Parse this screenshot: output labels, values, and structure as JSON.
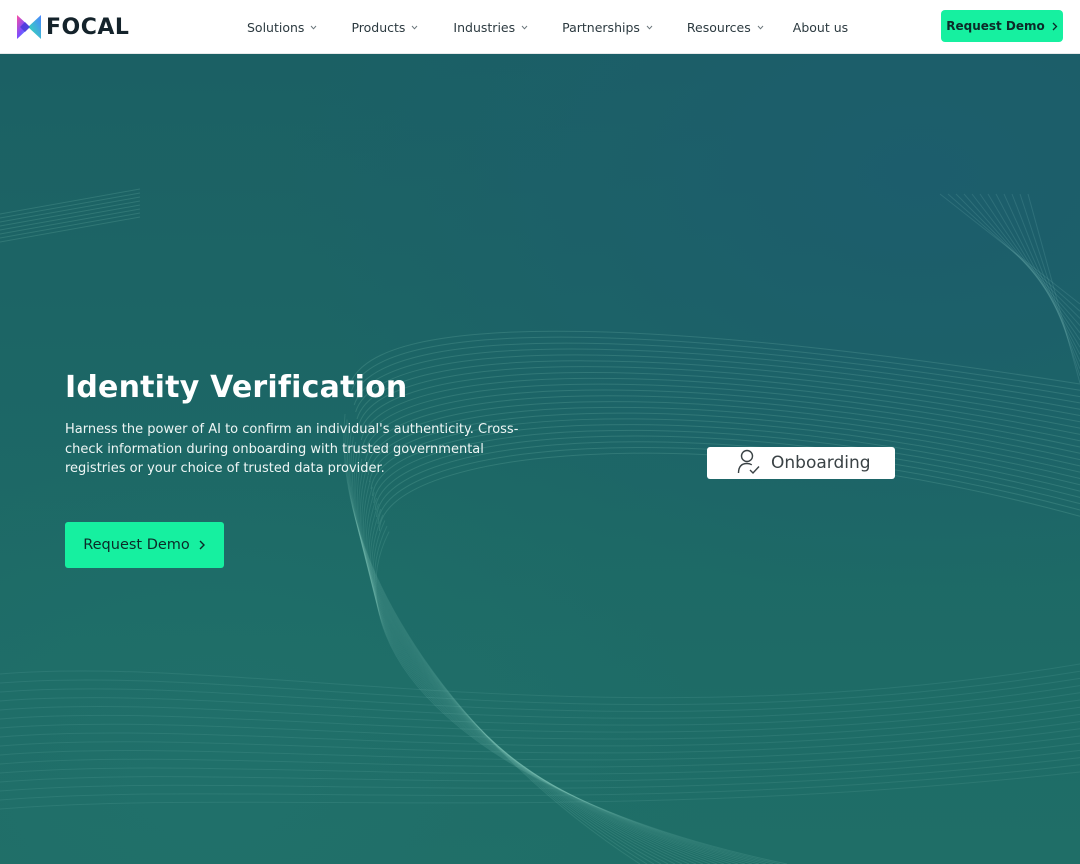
{
  "brand": {
    "name": "FOCAL",
    "logo_icon": "focal-logo-icon"
  },
  "nav": {
    "items": [
      {
        "label": "Solutions",
        "has_dropdown": true
      },
      {
        "label": "Products",
        "has_dropdown": true
      },
      {
        "label": "Industries",
        "has_dropdown": true
      },
      {
        "label": "Partnerships",
        "has_dropdown": true
      },
      {
        "label": "Resources",
        "has_dropdown": true
      },
      {
        "label": "About us",
        "has_dropdown": false
      }
    ],
    "cta_label": "Request Demo"
  },
  "hero": {
    "title": "Identity Verification",
    "description": "Harness the power of AI to confirm an individual's authenticity. Cross-check information during onboarding with trusted governmental registries or your choice of trusted data provider.",
    "cta_label": "Request Demo",
    "chip": {
      "label": "Onboarding",
      "icon": "user-check-icon"
    }
  },
  "colors": {
    "accent": "#16f0a0",
    "hero_background": "#1d6766",
    "nav_background": "#ffffff",
    "text_dark": "#2c3a40"
  }
}
